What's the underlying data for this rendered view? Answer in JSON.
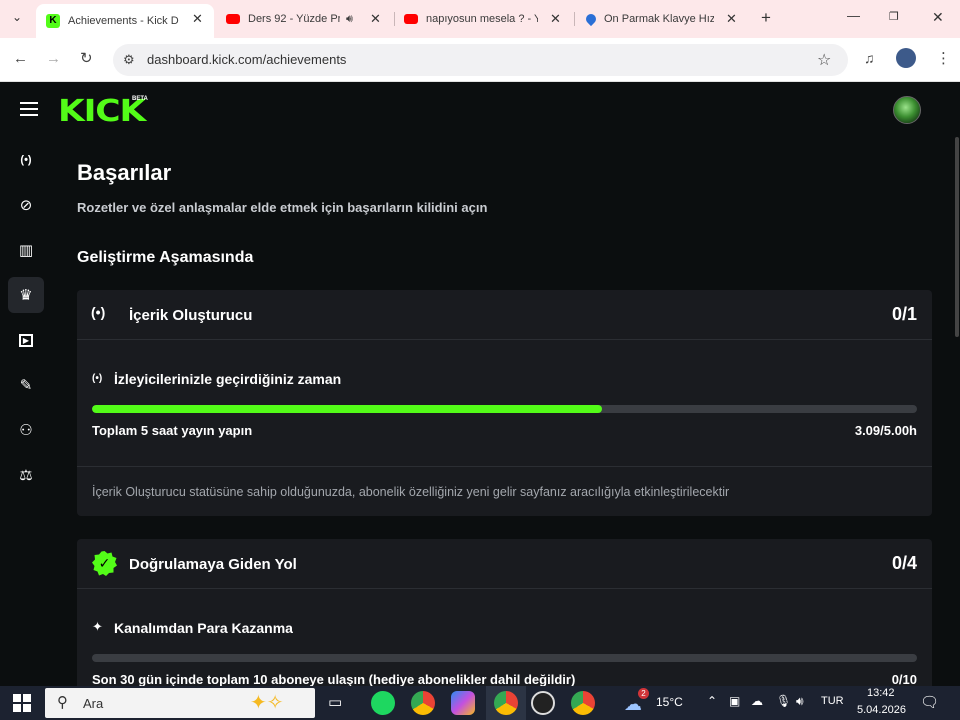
{
  "browser": {
    "tabs": [
      {
        "title": "Achievements - Kick D",
        "active": true,
        "favicon_color": "#53fc18"
      },
      {
        "title": "Ders 92 - Yüzde Pr",
        "active": false,
        "favicon_color": "#ff0000"
      },
      {
        "title": "napıyosun mesela ? - Y",
        "active": false,
        "favicon_color": "#ff0000"
      },
      {
        "title": "On Parmak Klavye Hız",
        "active": false,
        "favicon_color": "#2a6fd6"
      }
    ],
    "url": "dashboard.kick.com/achievements"
  },
  "topnav": {
    "logo": "KICK",
    "badge": "BETA"
  },
  "sidebar": {
    "items": [
      {
        "icon": "broadcast-icon",
        "glyph": "(•)",
        "active": false
      },
      {
        "icon": "link-icon",
        "glyph": "⊘",
        "active": false
      },
      {
        "icon": "analytics-icon",
        "glyph": "▥",
        "active": false
      },
      {
        "icon": "trophy-icon",
        "glyph": "♛",
        "active": true
      },
      {
        "icon": "video-icon",
        "glyph": "▶",
        "active": false
      },
      {
        "icon": "wrench-icon",
        "glyph": "✎",
        "active": false
      },
      {
        "icon": "community-icon",
        "glyph": "⚇",
        "active": false
      },
      {
        "icon": "payout-icon",
        "glyph": "⚖",
        "active": false
      }
    ]
  },
  "main": {
    "title": "Başarılar",
    "subtitle": "Rozetler ve özel anlaşmalar elde etmek için başarıların kilidini açın",
    "section": "Geliştirme Aşamasında",
    "cards": [
      {
        "title": "İçerik Oluşturucu",
        "count": "0/1",
        "icon": "broadcast-icon",
        "task_title": "İzleyicilerinizle geçirdiğiniz zaman",
        "task_icon": "broadcast-icon",
        "progress_fraction": 0.618,
        "requirement": "Toplam 5 saat yayın yapın",
        "progress_text": "3.09/5.00h",
        "note": "İçerik Oluşturucu statüsüne sahip olduğunuzda, abonelik özelliğiniz yeni gelir sayfanız aracılığıyla etkinleştirilecektir"
      },
      {
        "title": "Doğrulamaya Giden Yol",
        "count": "0/4",
        "icon": "verified-icon",
        "task_title": "Kanalımdan Para Kazanma",
        "task_icon": "sparkle-icon",
        "progress_fraction": 0,
        "requirement": "Son 30 gün içinde toplam 10 aboneye ulaşın (hediye abonelikler dahil değildir)",
        "progress_text": "0/10"
      }
    ]
  },
  "taskbar": {
    "search_placeholder": "Ara",
    "weather": "15°C",
    "weather_badge": "2",
    "language": "TUR",
    "time": "13:42",
    "date": "5.04.2026"
  },
  "colors": {
    "accent": "#53fc18",
    "card_bg": "#191b1f",
    "page_bg": "#0b0e0f"
  }
}
